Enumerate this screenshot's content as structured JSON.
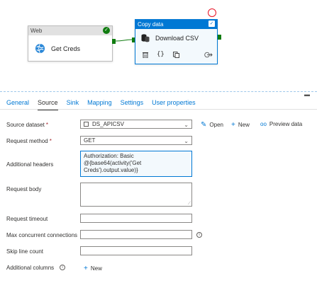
{
  "pipeline": {
    "web_activity": {
      "type_label": "Web",
      "name": "Get Creds"
    },
    "copy_activity": {
      "type_label": "Copy data",
      "name": "Download CSV"
    },
    "tool_icons": [
      "delete-icon",
      "code-icon",
      "clone-icon",
      "output-arrow-icon"
    ]
  },
  "tabs": [
    {
      "label": "General",
      "active": false
    },
    {
      "label": "Source",
      "active": true
    },
    {
      "label": "Sink",
      "active": false
    },
    {
      "label": "Mapping",
      "active": false
    },
    {
      "label": "Settings",
      "active": false
    },
    {
      "label": "User properties",
      "active": false
    }
  ],
  "form": {
    "source_dataset": {
      "label": "Source dataset",
      "required": "*",
      "value": "DS_APICSV"
    },
    "dataset_actions": {
      "open": "Open",
      "new": "New",
      "preview": "Preview data"
    },
    "request_method": {
      "label": "Request method",
      "required": "*",
      "value": "GET"
    },
    "additional_headers": {
      "label": "Additional headers",
      "line1": "Authorization: Basic",
      "line2": "@{base64(activity('Get",
      "line3": "Creds').output.value)}"
    },
    "request_body": {
      "label": "Request body",
      "value": ""
    },
    "request_timeout": {
      "label": "Request timeout",
      "value": ""
    },
    "max_concurrent": {
      "label": "Max concurrent connections",
      "value": ""
    },
    "skip_line_count": {
      "label": "Skip line count",
      "value": ""
    },
    "additional_columns": {
      "label": "Additional columns",
      "new": "New"
    }
  },
  "colors": {
    "accent": "#0078d4",
    "success": "#107c10",
    "error": "#e81123"
  }
}
